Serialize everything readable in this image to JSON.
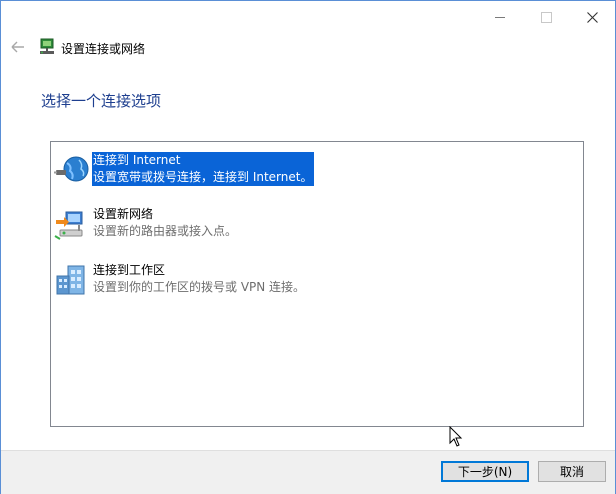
{
  "window": {
    "controls": {
      "minimize_icon": "minimize-icon",
      "maximize_icon": "maximize-icon",
      "close_icon": "close-icon"
    }
  },
  "header": {
    "title": "设置连接或网络"
  },
  "page": {
    "heading": "选择一个连接选项"
  },
  "options": [
    {
      "title": "连接到 Internet",
      "description": "设置宽带或拨号连接，连接到 Internet。",
      "icon": "globe-icon",
      "selected": true
    },
    {
      "title": "设置新网络",
      "description": "设置新的路由器或接入点。",
      "icon": "new-network-icon",
      "selected": false
    },
    {
      "title": "连接到工作区",
      "description": "设置到你的工作区的拨号或 VPN 连接。",
      "icon": "workplace-icon",
      "selected": false
    }
  ],
  "footer": {
    "next_label": "下一步(N)",
    "cancel_label": "取消"
  },
  "colors": {
    "selection": "#0a64d7",
    "heading": "#1e3f8f",
    "window_border": "#5a8fd6",
    "footer_bg": "#f0f0f0"
  }
}
